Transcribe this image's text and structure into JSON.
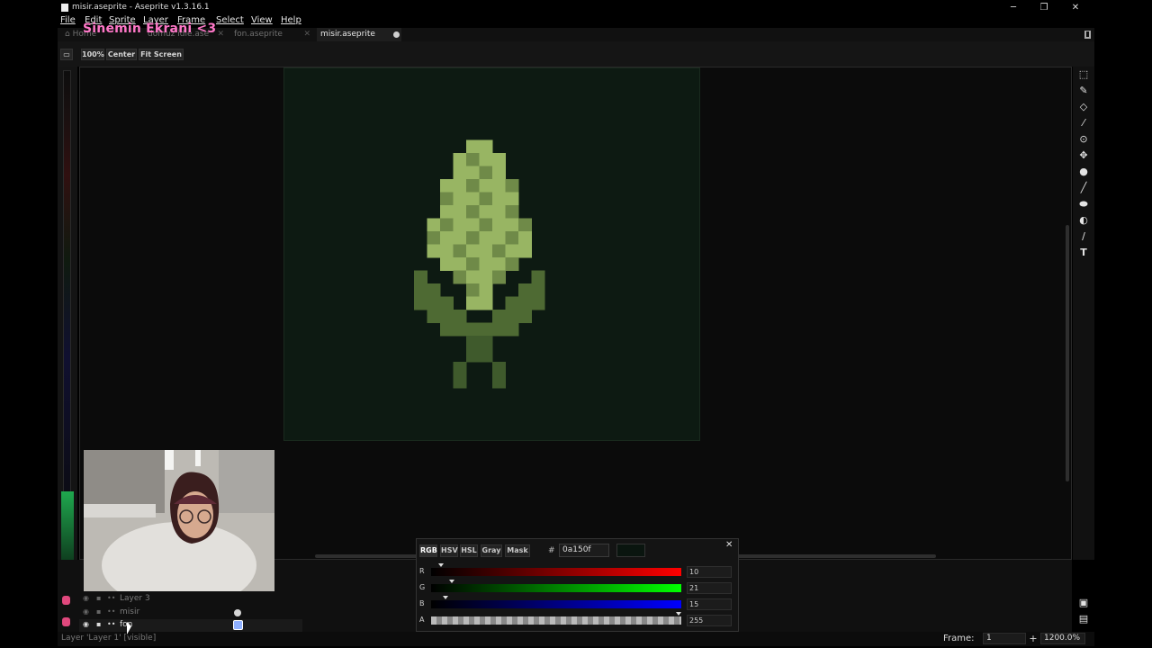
{
  "window": {
    "title": "misir.aseprite - Aseprite v1.3.16.1",
    "minimize": "─",
    "maximize": "❐",
    "close": "✕"
  },
  "menu": [
    "File",
    "Edit",
    "Sprite",
    "Layer",
    "Frame",
    "Select",
    "View",
    "Help"
  ],
  "overlay": "Sinemin Ekrani <3",
  "tabs": [
    {
      "label": "Home",
      "active": false
    },
    {
      "label": "domuz idle.ase",
      "active": false
    },
    {
      "label": "fon.aseprite",
      "active": false
    },
    {
      "label": "misir.aseprite",
      "active": true
    }
  ],
  "toolbar": {
    "zoom_label": "100%",
    "center_label": "Center",
    "fit_label": "Fit Screen"
  },
  "tools": [
    "select-icon",
    "pencil-icon",
    "eraser-icon",
    "eyedropper-icon",
    "zoom-icon",
    "move-icon",
    "fill-icon",
    "line-icon",
    "ellipse-icon",
    "blur-icon",
    "spray-icon",
    "text-icon"
  ],
  "colors": {
    "canvas_bg": "#0d1a12",
    "light_green": "#98b563",
    "mid_green": "#6f8a48",
    "dark_leaf": "#4e6a33",
    "stem": "#3f5a2c",
    "fg_color": "#0a150f"
  },
  "layers": [
    {
      "name": "Layer 3",
      "has_cel": false,
      "selected": false
    },
    {
      "name": "misir",
      "has_cel": true,
      "selected": false
    },
    {
      "name": "fon",
      "has_cel": true,
      "selected": true
    }
  ],
  "color_panel": {
    "modes": [
      "RGB",
      "HSV",
      "HSL",
      "Gray",
      "Mask"
    ],
    "active_mode": "RGB",
    "hex": "0a150f",
    "channels": [
      {
        "label": "R",
        "value": "10"
      },
      {
        "label": "G",
        "value": "21"
      },
      {
        "label": "B",
        "value": "15"
      },
      {
        "label": "A",
        "value": "255"
      }
    ]
  },
  "status": {
    "text": "Layer 'Layer 1' [visible]",
    "frame_label": "Frame:",
    "frame_value": "1",
    "zoom": "1200.0%"
  }
}
